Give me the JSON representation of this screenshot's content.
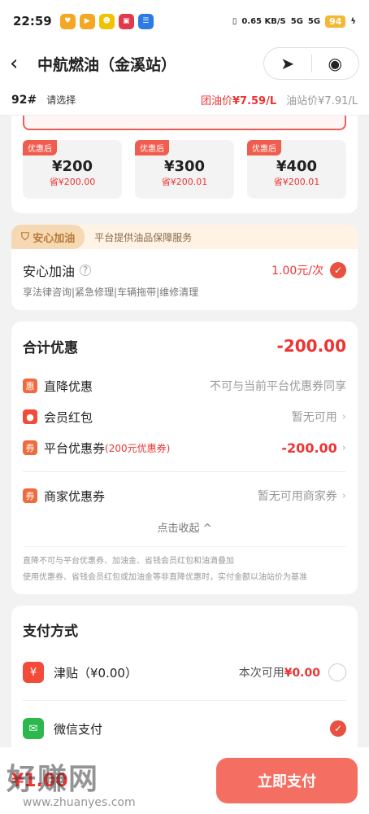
{
  "status": {
    "time": "22:59",
    "net": "0.65\nKB/S",
    "sig1": "5G",
    "sig2": "5G",
    "battery": "94"
  },
  "header": {
    "title": "中航燃油（金溪站）",
    "back_icon": "chevron-left-icon",
    "locate_icon": "navigation-arrow-icon",
    "record_icon": "record-circle-icon"
  },
  "fuel": {
    "grade": "92#",
    "select": "请选择",
    "tuan_label": "团油价",
    "tuan_price": "¥7.59/L",
    "station_label": "油站价",
    "station_price": "¥7.91/L"
  },
  "amounts": {
    "tag": "优惠后",
    "items": [
      {
        "value": "¥200",
        "save": "省¥200.00"
      },
      {
        "value": "¥300",
        "save": "省¥200.01"
      },
      {
        "value": "¥400",
        "save": "省¥200.01"
      }
    ]
  },
  "anxin": {
    "badge": "安心加油",
    "subtitle": "平台提供油品保障服务",
    "name": "安心加油",
    "help": "?",
    "price": "1.00元/次",
    "desc": "享法律咨询|紧急修理|车辆拖带|维修清理"
  },
  "discount": {
    "title": "合计优惠",
    "total": "-200.00",
    "rows": [
      {
        "icon": "惠",
        "label": "直降优惠",
        "value": "不可与当前平台优惠券同享"
      },
      {
        "icon": "●",
        "label": "会员红包",
        "value": "暂无可用"
      },
      {
        "icon": "券",
        "label": "平台优惠券",
        "note": "(200元优惠券)",
        "value": "-200.00"
      },
      {
        "icon": "券",
        "label": "商家优惠券",
        "value": "暂无可用商家券"
      }
    ],
    "collapse": "点击收起 ^",
    "fine1": "直降不可与平台优惠券、加油金、省钱会员红包和油滴叠加",
    "fine2": "使用优惠券、省钱会员红包或加油金等非直降优惠时，实付金额以油站价为基准"
  },
  "pay": {
    "title": "支付方式",
    "jintie": {
      "label": "津贴（¥0.00）",
      "avail_label": "本次可用",
      "avail_value": "¥0.00"
    },
    "wechat": {
      "label": "微信支付"
    }
  },
  "bottom": {
    "amount": "¥1.00",
    "button": "立即支付"
  },
  "watermark": {
    "text": "好赚网",
    "url": "www.zhuanyes.com"
  },
  "colors": {
    "accent": "#e8503f",
    "button": "#f56e62"
  }
}
